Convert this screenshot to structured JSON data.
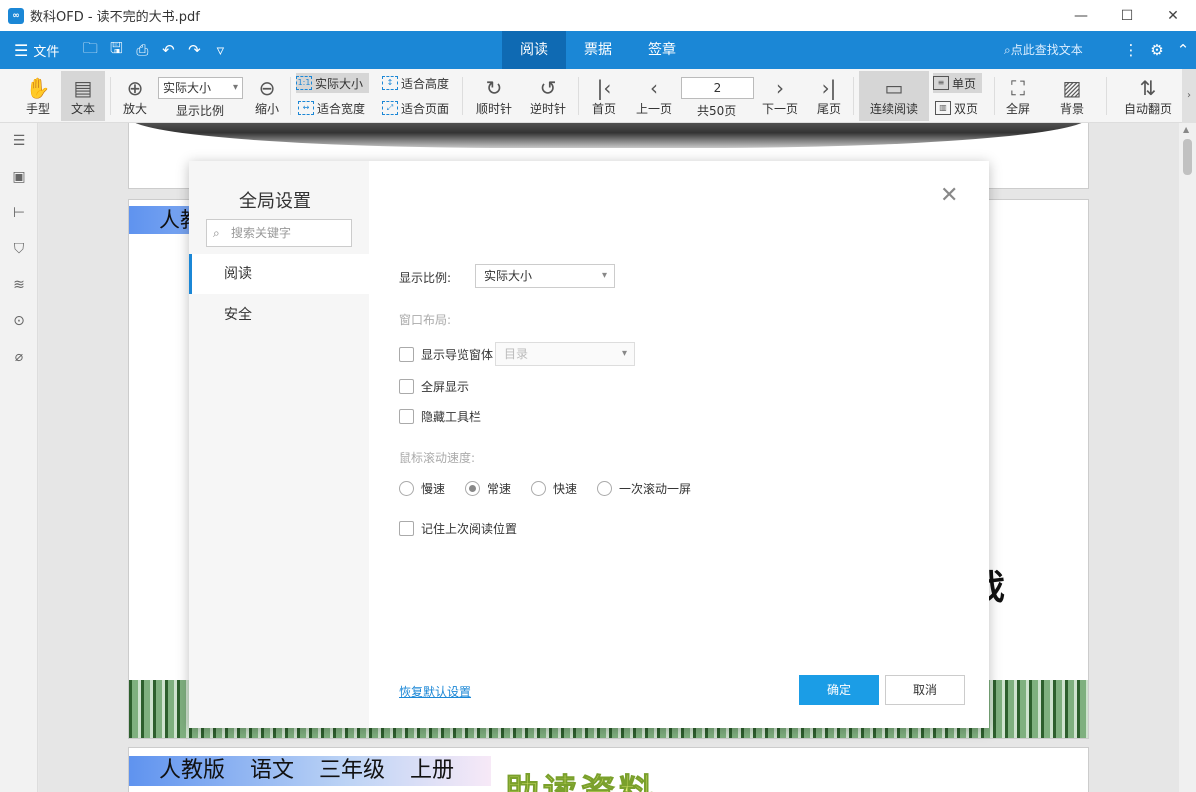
{
  "window": {
    "logo": "∞",
    "title": "数科OFD - 读不完的大书.pdf",
    "controls": {
      "minimize": "—",
      "maximize": "☐",
      "close": "✕"
    }
  },
  "menubar": {
    "file_label": "文件",
    "tabs": [
      {
        "label": "阅读",
        "active": true
      },
      {
        "label": "票据",
        "active": false
      },
      {
        "label": "签章",
        "active": false
      }
    ],
    "search_placeholder": "点此查找文本"
  },
  "toolbar": {
    "hand": "手型",
    "text": "文本",
    "zoom_in": "放大",
    "zoom_select_value": "实际大小",
    "zoom_label": "显示比例",
    "zoom_out": "缩小",
    "actual_size": "实际大小",
    "fit_height": "适合高度",
    "fit_width": "适合宽度",
    "fit_page": "适合页面",
    "rotate_cw": "顺时针",
    "rotate_ccw": "逆时针",
    "first_page": "首页",
    "prev_page": "上一页",
    "page_value": "2",
    "total_pages": "共50页",
    "next_page": "下一页",
    "last_page": "尾页",
    "continuous": "连续阅读",
    "single_page": "单页",
    "double_page": "双页",
    "fullscreen": "全屏",
    "background": "背景",
    "auto_flip": "自动翻页"
  },
  "document": {
    "page2_header": "人教",
    "page3_header": "人教版 语文 三年级 上册",
    "page3_title": "助读资料",
    "ink_glyph": "戏"
  },
  "dialog": {
    "title": "全局设置",
    "search_placeholder": "搜索关键字",
    "nav": [
      {
        "label": "阅读",
        "active": true
      },
      {
        "label": "安全",
        "active": false
      }
    ],
    "zoom_label": "显示比例:",
    "zoom_value": "实际大小",
    "window_layout_label": "窗口布局:",
    "show_nav_pane": "显示导览窗体",
    "nav_pane_select": "目录",
    "fullscreen_display": "全屏显示",
    "hide_toolbar": "隐藏工具栏",
    "scroll_speed_label": "鼠标滚动速度:",
    "speeds": [
      {
        "label": "慢速",
        "checked": false
      },
      {
        "label": "常速",
        "checked": true
      },
      {
        "label": "快速",
        "checked": false
      },
      {
        "label": "一次滚动一屏",
        "checked": false
      }
    ],
    "remember_position": "记住上次阅读位置",
    "restore_defaults": "恢复默认设置",
    "ok": "确定",
    "cancel": "取消",
    "close": "✕"
  },
  "colors": {
    "brand_blue": "#1b87d6",
    "active_tab": "#0f6ab3",
    "ok_button": "#1b9de6"
  }
}
